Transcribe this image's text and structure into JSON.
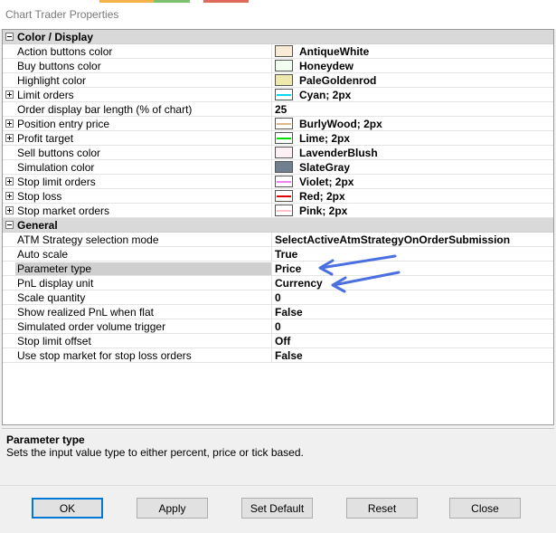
{
  "window": {
    "title": "Chart Trader Properties"
  },
  "categories": {
    "color": "Color / Display",
    "general": "General"
  },
  "color_rows": [
    {
      "name": "Action buttons color",
      "value": "AntiqueWhite",
      "color": "#FAEBD7",
      "expandable": false,
      "line": false
    },
    {
      "name": "Buy buttons color",
      "value": "Honeydew",
      "color": "#F0FFF0",
      "expandable": false,
      "line": false
    },
    {
      "name": "Highlight color",
      "value": "PaleGoldenrod",
      "color": "#EEE8AA",
      "expandable": false,
      "line": false
    },
    {
      "name": "Limit orders",
      "value": "Cyan; 2px",
      "color": "#00D8F0",
      "expandable": true,
      "line": true
    },
    {
      "name": "Order display bar length (% of chart)",
      "value": "25",
      "color": "",
      "expandable": false,
      "line": false
    },
    {
      "name": "Position entry price",
      "value": "BurlyWood; 2px",
      "color": "#DEB887",
      "expandable": true,
      "line": true
    },
    {
      "name": "Profit target",
      "value": "Lime; 2px",
      "color": "#00E000",
      "expandable": true,
      "line": true
    },
    {
      "name": "Sell buttons color",
      "value": "LavenderBlush",
      "color": "#FFF0F5",
      "expandable": false,
      "line": false
    },
    {
      "name": "Simulation color",
      "value": "SlateGray",
      "color": "#708090",
      "expandable": false,
      "line": false
    },
    {
      "name": "Stop limit orders",
      "value": "Violet; 2px",
      "color": "#EE82EE",
      "expandable": true,
      "line": true
    },
    {
      "name": "Stop loss",
      "value": "Red; 2px",
      "color": "#E00000",
      "expandable": true,
      "line": true
    },
    {
      "name": "Stop market orders",
      "value": "Pink; 2px",
      "color": "#FFC0CB",
      "expandable": true,
      "line": true
    }
  ],
  "general_rows": [
    {
      "name": "ATM Strategy selection mode",
      "value": "SelectActiveAtmStrategyOnOrderSubmission"
    },
    {
      "name": "Auto scale",
      "value": "True"
    },
    {
      "name": "Parameter type",
      "value": "Price",
      "selected": true
    },
    {
      "name": "PnL display unit",
      "value": "Currency"
    },
    {
      "name": "Scale quantity",
      "value": "0"
    },
    {
      "name": "Show realized PnL when flat",
      "value": "False"
    },
    {
      "name": "Simulated order volume trigger",
      "value": "0"
    },
    {
      "name": "Stop limit offset",
      "value": "Off"
    },
    {
      "name": "Use stop market for stop loss orders",
      "value": "False"
    }
  ],
  "description": {
    "title": "Parameter type",
    "text": "Sets the input value type to either percent, price or tick based."
  },
  "buttons": {
    "ok": "OK",
    "apply": "Apply",
    "set_default": "Set Default",
    "reset": "Reset",
    "close": "Close"
  },
  "colors": {
    "annotation_arrow": "#4a6fe0",
    "default_button_border": "#0078d7"
  }
}
